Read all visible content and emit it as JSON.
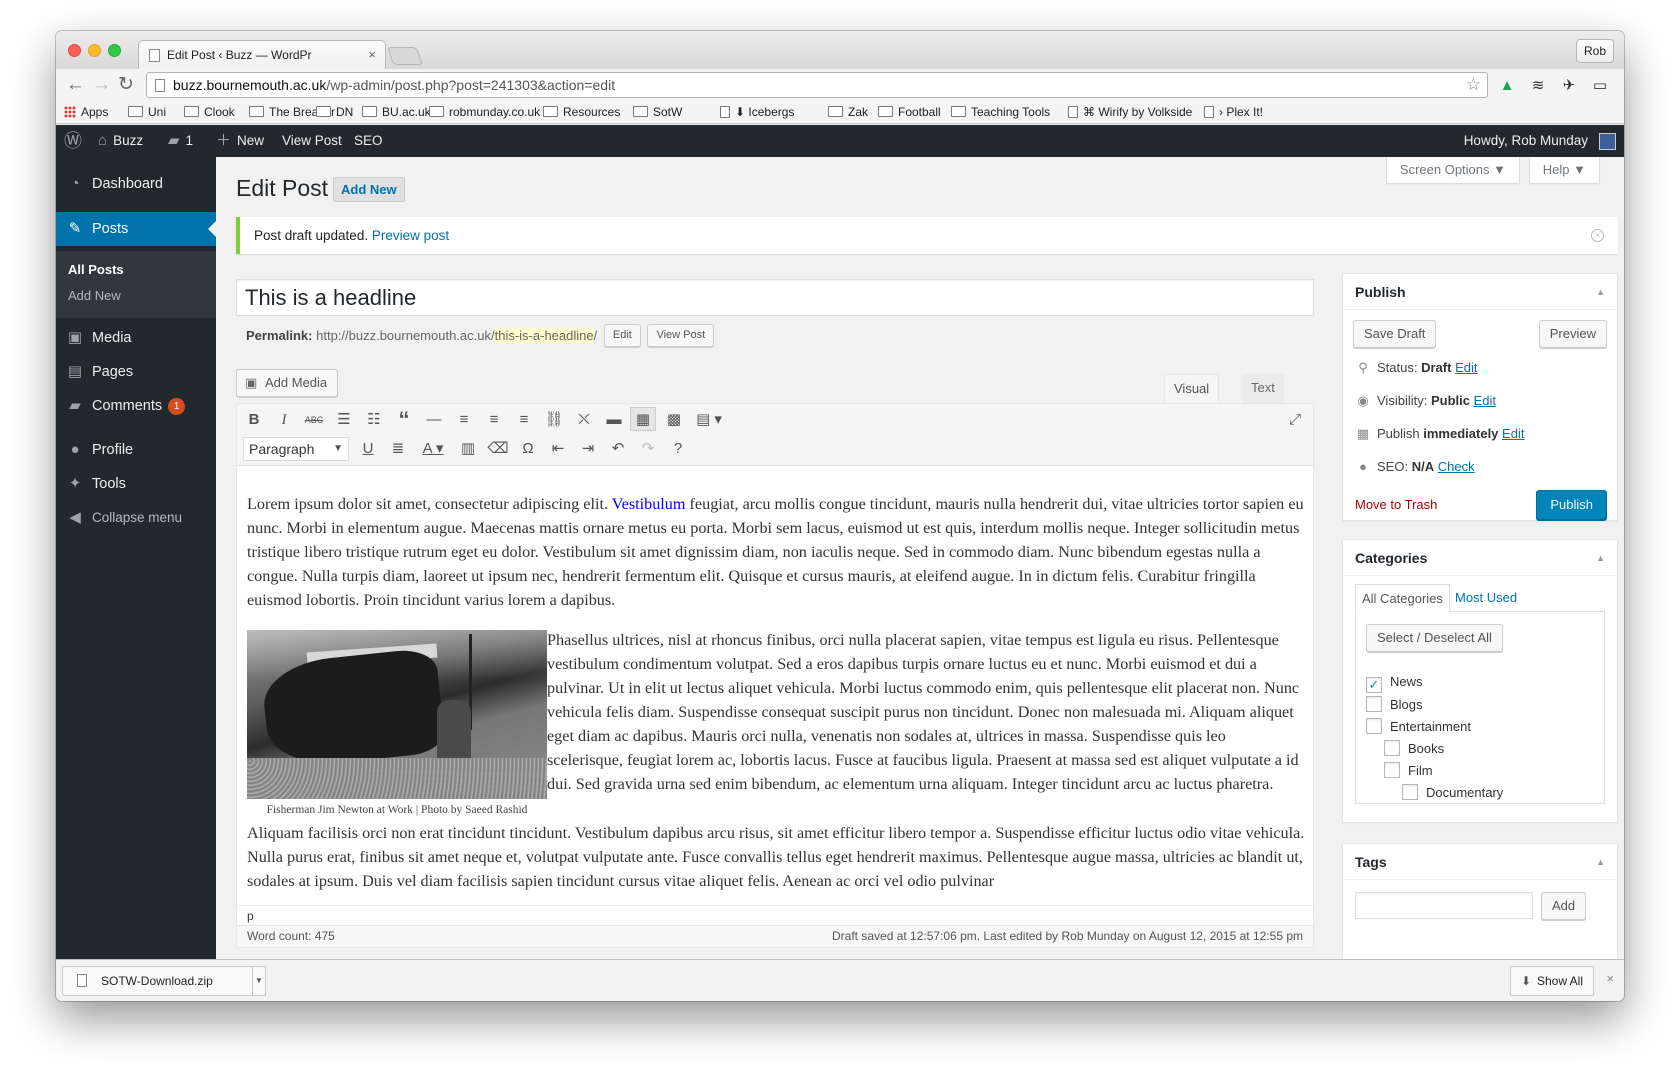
{
  "browser": {
    "tab_title": "Edit Post ‹ Buzz — WordPr",
    "profile": "Rob",
    "url_host": "buzz.bournemouth.ac.uk",
    "url_path": "/wp-admin/post.php?post=241303&action=edit",
    "bookmarks": [
      {
        "label": "Apps",
        "kind": "apps"
      },
      {
        "label": "Uni",
        "kind": "folder"
      },
      {
        "label": "Clook",
        "kind": "folder"
      },
      {
        "label": "The Breaker",
        "kind": "folder"
      },
      {
        "label": "DN",
        "kind": "folder"
      },
      {
        "label": "BU.ac.uk",
        "kind": "folder"
      },
      {
        "label": "robmunday.co.uk",
        "kind": "folder"
      },
      {
        "label": "Resources",
        "kind": "folder"
      },
      {
        "label": "SotW",
        "kind": "folder"
      },
      {
        "label": "⬇ Icebergs",
        "kind": "page"
      },
      {
        "label": "Zak",
        "kind": "folder"
      },
      {
        "label": "Football",
        "kind": "folder"
      },
      {
        "label": "Teaching Tools",
        "kind": "folder"
      },
      {
        "label": "⌘ Wirify by Volkside",
        "kind": "page"
      },
      {
        "label": "› Plex It!",
        "kind": "page"
      }
    ]
  },
  "adminbar": {
    "site": "Buzz",
    "comments_count": "1",
    "new_label": "New",
    "view_post": "View Post",
    "seo": "SEO",
    "howdy": "Howdy, Rob Munday"
  },
  "sidebar": {
    "dashboard": "Dashboard",
    "posts": "Posts",
    "all_posts": "All Posts",
    "add_new": "Add New",
    "media": "Media",
    "pages": "Pages",
    "comments": "Comments",
    "comments_badge": "1",
    "profile": "Profile",
    "tools": "Tools",
    "collapse": "Collapse menu"
  },
  "page": {
    "screen_options": "Screen Options ▼",
    "help": "Help ▼",
    "title": "Edit Post",
    "add_new": "Add New",
    "notice_text": "Post draft updated.",
    "notice_link": "Preview post",
    "post_title": "This is a headline",
    "permalink_label": "Permalink:",
    "permalink_base": "http://buzz.bournemouth.ac.uk/",
    "permalink_slug": "this-is-a-headline",
    "permalink_end": "/",
    "edit_btn": "Edit",
    "view_post_btn": "View Post",
    "add_media": "Add Media",
    "tab_visual": "Visual",
    "tab_text": "Text",
    "format_select": "Paragraph"
  },
  "content": {
    "p1_before": "Lorem ipsum dolor sit amet, consectetur adipiscing elit. ",
    "p1_link": "Vestibulum",
    "p1_after": " feugiat, arcu mollis congue tincidunt, mauris nulla hendrerit dui, vitae ultricies tortor sapien eu nunc. Morbi in elementum augue. Maecenas mattis ornare metus eu porta. Morbi sem lacus, euismod ut est quis, interdum mollis neque. Integer sollicitudin metus tristique libero tristique rutrum eget eu dolor. Vestibulum sit amet dignissim diam, non iaculis neque. Sed in commodo diam. Nunc bibendum egestas nulla a congue. Nulla turpis diam, laoreet ut ipsum nec, hendrerit fermentum elit. Quisque et cursus mauris, at eleifend augue. In in dictum felis. Curabitur fringilla euismod lobortis. Proin tincidunt varius lorem a dapibus.",
    "caption": "Fisherman Jim Newton at Work | Photo by Saeed Rashid",
    "p2": "Phasellus ultrices, nisl at rhoncus finibus, orci nulla placerat sapien, vitae tempus est ligula eu risus. Pellentesque vestibulum condimentum volutpat. Sed a eros dapibus turpis ornare luctus eu et nunc. Morbi euismod et dui a pulvinar. Ut in elit ut lectus aliquet vehicula. Morbi luctus commodo enim, quis pellentesque elit placerat non. Nunc vehicula felis diam. Suspendisse consequat suscipit purus non tincidunt. Donec non malesuada mi. Aliquam aliquet eget diam ac dapibus. Mauris orci nulla, venenatis non sodales at, ultrices in massa. Suspendisse quis leo scelerisque, feugiat lorem ac, lobortis lacus. Fusce at faucibus ligula. Praesent at massa sed est aliquet vulputate a id dui. Sed gravida urna sed enim bibendum, ac elementum urna aliquam. Integer tincidunt arcu ac luctus pharetra.",
    "p3": "Aliquam facilisis orci non erat tincidunt tincidunt. Vestibulum dapibus arcu risus, sit amet efficitur libero tempor a. Suspendisse efficitur luctus odio vitae vehicula. Nulla purus erat, finibus sit amet neque et, volutpat vulputate ante. Fusce convallis tellus eget hendrerit maximus. Pellentesque augue massa, ultricies ac blandit ut, sodales at ipsum. Duis vel diam facilisis sapien tincidunt cursus vitae aliquet felis. Aenean ac orci vel odio pulvinar",
    "path": "p",
    "word_count": "Word count: 475",
    "draft_saved": "Draft saved at 12:57:06 pm. Last edited by Rob Munday on August 12, 2015 at 12:55 pm"
  },
  "publish": {
    "title": "Publish",
    "save_draft": "Save Draft",
    "preview": "Preview",
    "status_label": "Status:",
    "status_value": "Draft",
    "visibility_label": "Visibility:",
    "visibility_value": "Public",
    "publish_label": "Publish",
    "publish_value": "immediately",
    "seo_label": "SEO:",
    "seo_value": "N/A",
    "seo_link": "Check",
    "edit": "Edit",
    "trash": "Move to Trash",
    "publish_btn": "Publish"
  },
  "categories": {
    "title": "Categories",
    "tab_all": "All Categories",
    "tab_used": "Most Used",
    "select_all": "Select / Deselect All",
    "items": [
      {
        "label": "News",
        "checked": true,
        "level": 0
      },
      {
        "label": "Blogs",
        "checked": false,
        "level": 0
      },
      {
        "label": "Entertainment",
        "checked": false,
        "level": 0
      },
      {
        "label": "Books",
        "checked": false,
        "level": 1
      },
      {
        "label": "Film",
        "checked": false,
        "level": 1
      },
      {
        "label": "Documentary",
        "checked": false,
        "level": 2
      }
    ]
  },
  "tags": {
    "title": "Tags",
    "add": "Add"
  },
  "downloads": {
    "file": "SOTW-Download.zip",
    "show_all": "Show All"
  },
  "colors": {
    "admin_dark": "#23282d",
    "accent": "#0073aa",
    "notice_green": "#7ad03a",
    "badge": "#d54e21",
    "trash": "#aa0000"
  }
}
